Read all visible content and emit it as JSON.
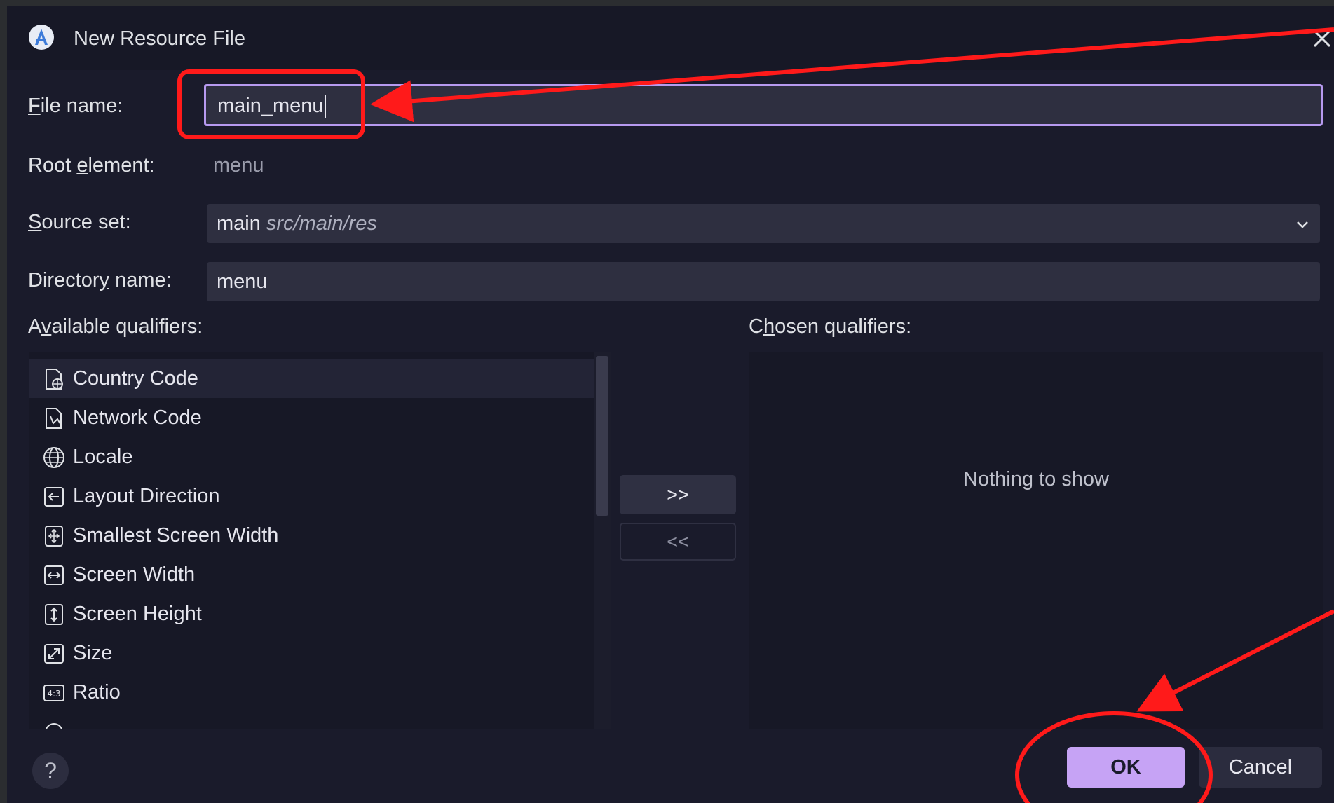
{
  "dialog": {
    "title": "New Resource File",
    "app_icon": "android-studio-icon",
    "close_icon": "close-icon"
  },
  "form": {
    "file_name": {
      "label_first": "F",
      "label_rest": "ile name:",
      "value": "main_menu"
    },
    "root_element": {
      "label_pre": "Root ",
      "label_mnemonic": "e",
      "label_post": "lement:",
      "value": "menu"
    },
    "source_set": {
      "label_first": "S",
      "label_rest": "ource set:",
      "value_main": "main",
      "value_path": "src/main/res"
    },
    "directory_name": {
      "label_pre": "Director",
      "label_mnemonic": "y",
      "label_post": " name:",
      "value": "menu"
    }
  },
  "available": {
    "label_pre": "A",
    "label_mnemonic": "v",
    "label_post": "ailable qualifiers:",
    "items": [
      {
        "label": "Country Code",
        "icon": "country-code-icon"
      },
      {
        "label": "Network Code",
        "icon": "network-code-icon"
      },
      {
        "label": "Locale",
        "icon": "globe-icon"
      },
      {
        "label": "Layout Direction",
        "icon": "layout-direction-icon"
      },
      {
        "label": "Smallest Screen Width",
        "icon": "smallest-width-icon"
      },
      {
        "label": "Screen Width",
        "icon": "screen-width-icon"
      },
      {
        "label": "Screen Height",
        "icon": "screen-height-icon"
      },
      {
        "label": "Size",
        "icon": "size-icon"
      },
      {
        "label": "Ratio",
        "icon": "ratio-icon"
      }
    ]
  },
  "transfer": {
    "add": ">>",
    "remove": "<<"
  },
  "chosen": {
    "label_pre": "C",
    "label_mnemonic": "h",
    "label_post": "osen qualifiers:",
    "empty_text": "Nothing to show"
  },
  "footer": {
    "help": "?",
    "ok": "OK",
    "cancel": "Cancel"
  },
  "colors": {
    "accent": "#c6a3f5",
    "focus_border": "#b79af0",
    "annotation": "#ff1a1a",
    "background": "#1a1b2b"
  }
}
